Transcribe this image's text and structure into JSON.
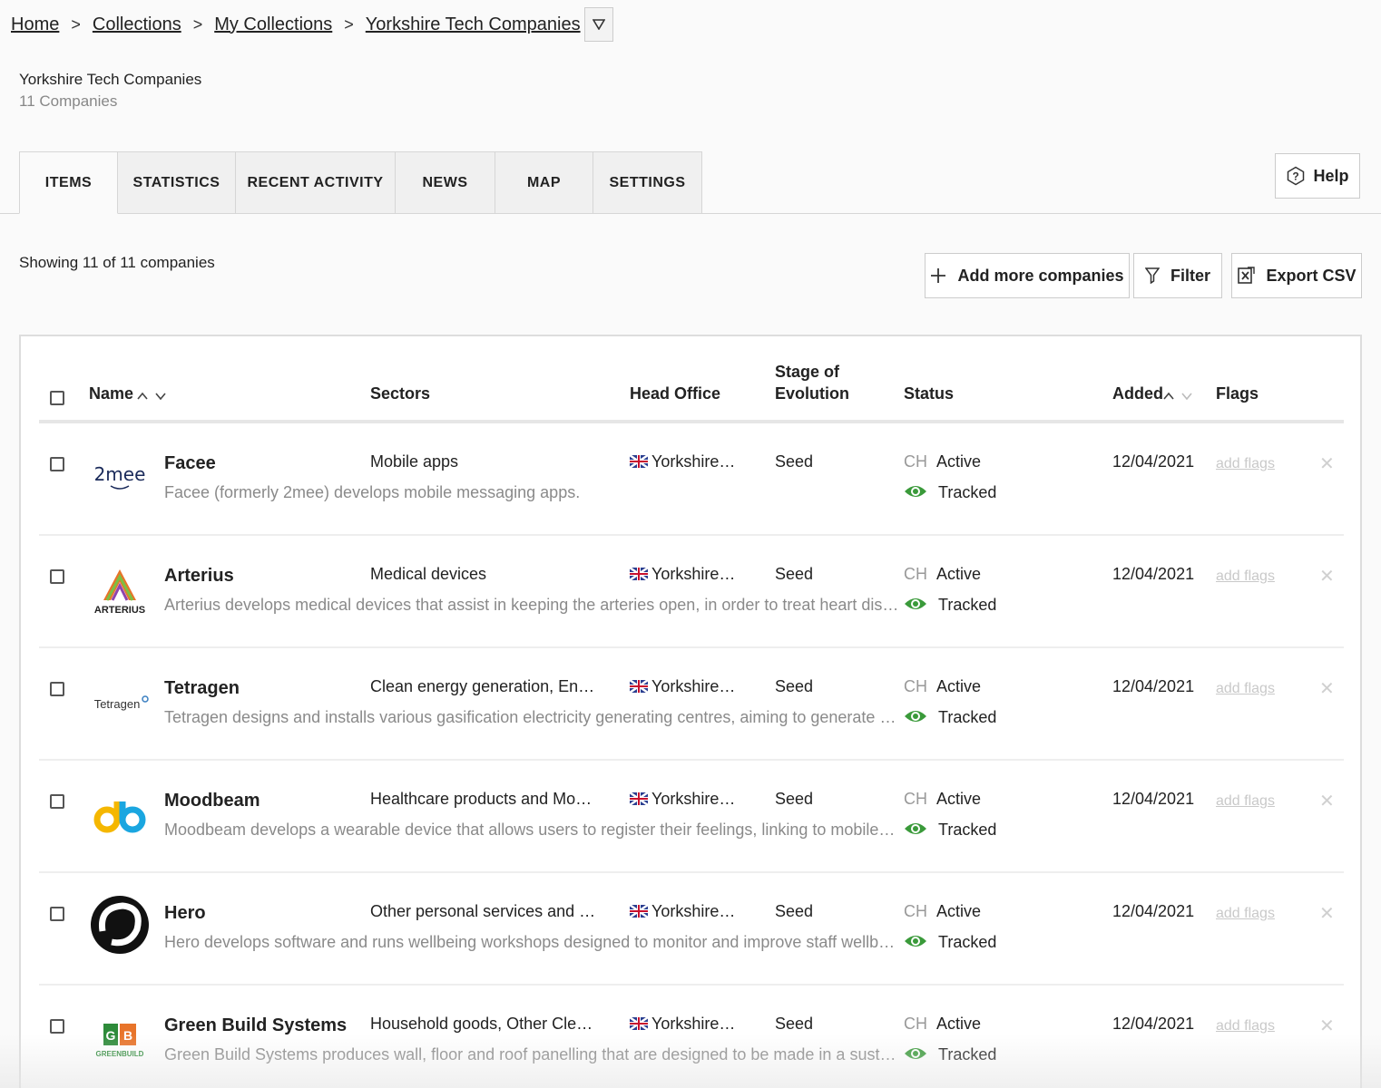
{
  "breadcrumb": {
    "items": [
      "Home",
      "Collections",
      "My Collections",
      "Yorkshire Tech Companies"
    ],
    "separator": ">"
  },
  "collection": {
    "title": "Yorkshire Tech Companies",
    "subtitle": "11 Companies"
  },
  "tabs": [
    "ITEMS",
    "STATISTICS",
    "RECENT ACTIVITY",
    "NEWS",
    "MAP",
    "SETTINGS"
  ],
  "active_tab": "ITEMS",
  "help_label": "Help",
  "showing_text": "Showing 11 of 11 companies",
  "actions": {
    "add_label": "Add more companies",
    "filter_label": "Filter",
    "export_label": "Export CSV"
  },
  "table": {
    "headers": {
      "name": "Name",
      "sectors": "Sectors",
      "head_office": "Head Office",
      "stage_line1": "Stage of",
      "stage_line2": "Evolution",
      "status": "Status",
      "added": "Added",
      "flags": "Flags"
    },
    "rows": [
      {
        "name": "Facee",
        "sectors": "Mobile apps",
        "head_office": "Yorkshire…",
        "stage": "Seed",
        "status_prefix": "CH",
        "status": "Active",
        "tracking": "Tracked",
        "added": "12/04/2021",
        "flags": "add flags",
        "description": "Facee (formerly 2mee) develops mobile messaging apps.",
        "logo": "2mee"
      },
      {
        "name": "Arterius",
        "sectors": "Medical devices",
        "head_office": "Yorkshire…",
        "stage": "Seed",
        "status_prefix": "CH",
        "status": "Active",
        "tracking": "Tracked",
        "added": "12/04/2021",
        "flags": "add flags",
        "description": "Arterius develops medical devices that assist in keeping the arteries open, in order to treat heart disease, a…",
        "logo": "ARTERIUS"
      },
      {
        "name": "Tetragen",
        "sectors": "Clean energy generation, En…",
        "head_office": "Yorkshire…",
        "stage": "Seed",
        "status_prefix": "CH",
        "status": "Active",
        "tracking": "Tracked",
        "added": "12/04/2021",
        "flags": "add flags",
        "description": "Tetragen designs and installs various gasification electricity generating centres, aiming to generate renewa…",
        "logo": "Tetragen"
      },
      {
        "name": "Moodbeam",
        "sectors": "Healthcare products and Mo…",
        "head_office": "Yorkshire…",
        "stage": "Seed",
        "status_prefix": "CH",
        "status": "Active",
        "tracking": "Tracked",
        "added": "12/04/2021",
        "flags": "add flags",
        "description": "Moodbeam develops a wearable device that allows users to register their feelings, linking to mobile app so…",
        "logo": "moodbeam"
      },
      {
        "name": "Hero",
        "sectors": "Other personal services and …",
        "head_office": "Yorkshire…",
        "stage": "Seed",
        "status_prefix": "CH",
        "status": "Active",
        "tracking": "Tracked",
        "added": "12/04/2021",
        "flags": "add flags",
        "description": "Hero develops software and runs wellbeing workshops designed to monitor and improve staff wellbeing.",
        "logo": "hero"
      },
      {
        "name": "Green Build Systems",
        "sectors": "Household goods, Other Cle…",
        "head_office": "Yorkshire…",
        "stage": "Seed",
        "status_prefix": "CH",
        "status": "Active",
        "tracking": "Tracked",
        "added": "12/04/2021",
        "flags": "add flags",
        "description": "Green Build Systems produces wall, floor and roof panelling that are designed to be made in a sustainable …",
        "logo": "GREENBUILD"
      }
    ]
  },
  "colors": {
    "tracked_eye": "#3a9a3a",
    "muted_text": "#8a8a8a",
    "border": "#d6d6d6"
  }
}
